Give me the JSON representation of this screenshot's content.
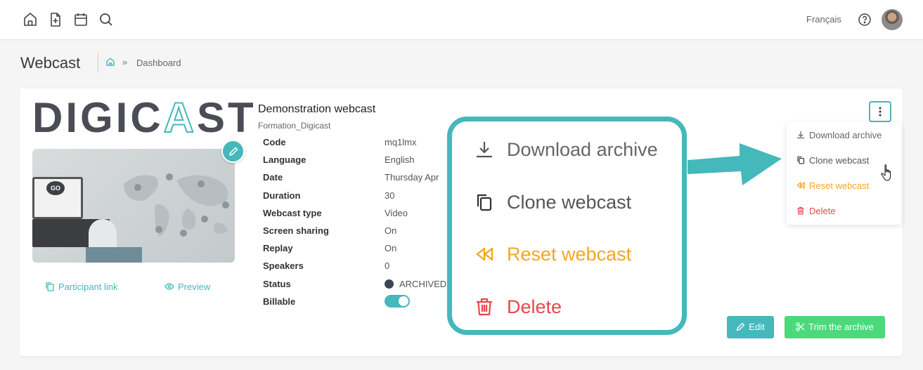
{
  "topbar": {
    "icons": [
      "home-icon",
      "add-document-icon",
      "calendar-icon",
      "search-icon"
    ],
    "language": "Français",
    "help_icon": "help-circle-icon"
  },
  "page": {
    "title": "Webcast",
    "breadcrumb": {
      "separator": "»",
      "current": "Dashboard"
    }
  },
  "card": {
    "logo_text": "DIGICAST",
    "participant_link": "Participant link",
    "preview": "Preview",
    "webcast_title": "Demonstration webcast",
    "webcast_subtitle": "Formation_Digicast",
    "details": [
      {
        "label": "Code",
        "value": "mq1lmx"
      },
      {
        "label": "Language",
        "value": "English"
      },
      {
        "label": "Date",
        "value": "Thursday Apr"
      },
      {
        "label": "Duration",
        "value": "30"
      },
      {
        "label": "Webcast type",
        "value": "Video"
      },
      {
        "label": "Screen sharing",
        "value": "On"
      },
      {
        "label": "Replay",
        "value": "On"
      },
      {
        "label": "Speakers",
        "value": "0"
      },
      {
        "label": "Status",
        "value": "ARCHIVED"
      },
      {
        "label": "Billable",
        "value": ""
      }
    ],
    "billable_on": true,
    "edit_button": "Edit",
    "trim_button": "Trim the archive"
  },
  "menu": {
    "items": [
      {
        "label": "Download archive",
        "color": "#666666",
        "icon": "download-icon"
      },
      {
        "label": "Clone webcast",
        "color": "#555555",
        "icon": "copy-icon"
      },
      {
        "label": "Reset webcast",
        "color": "#f5a623",
        "icon": "rewind-icon"
      },
      {
        "label": "Delete",
        "color": "#e8474d",
        "icon": "trash-icon"
      }
    ]
  },
  "colors": {
    "accent": "#45b8bc",
    "success": "#4cd97b",
    "warning": "#f5a623",
    "danger": "#e8474d"
  }
}
